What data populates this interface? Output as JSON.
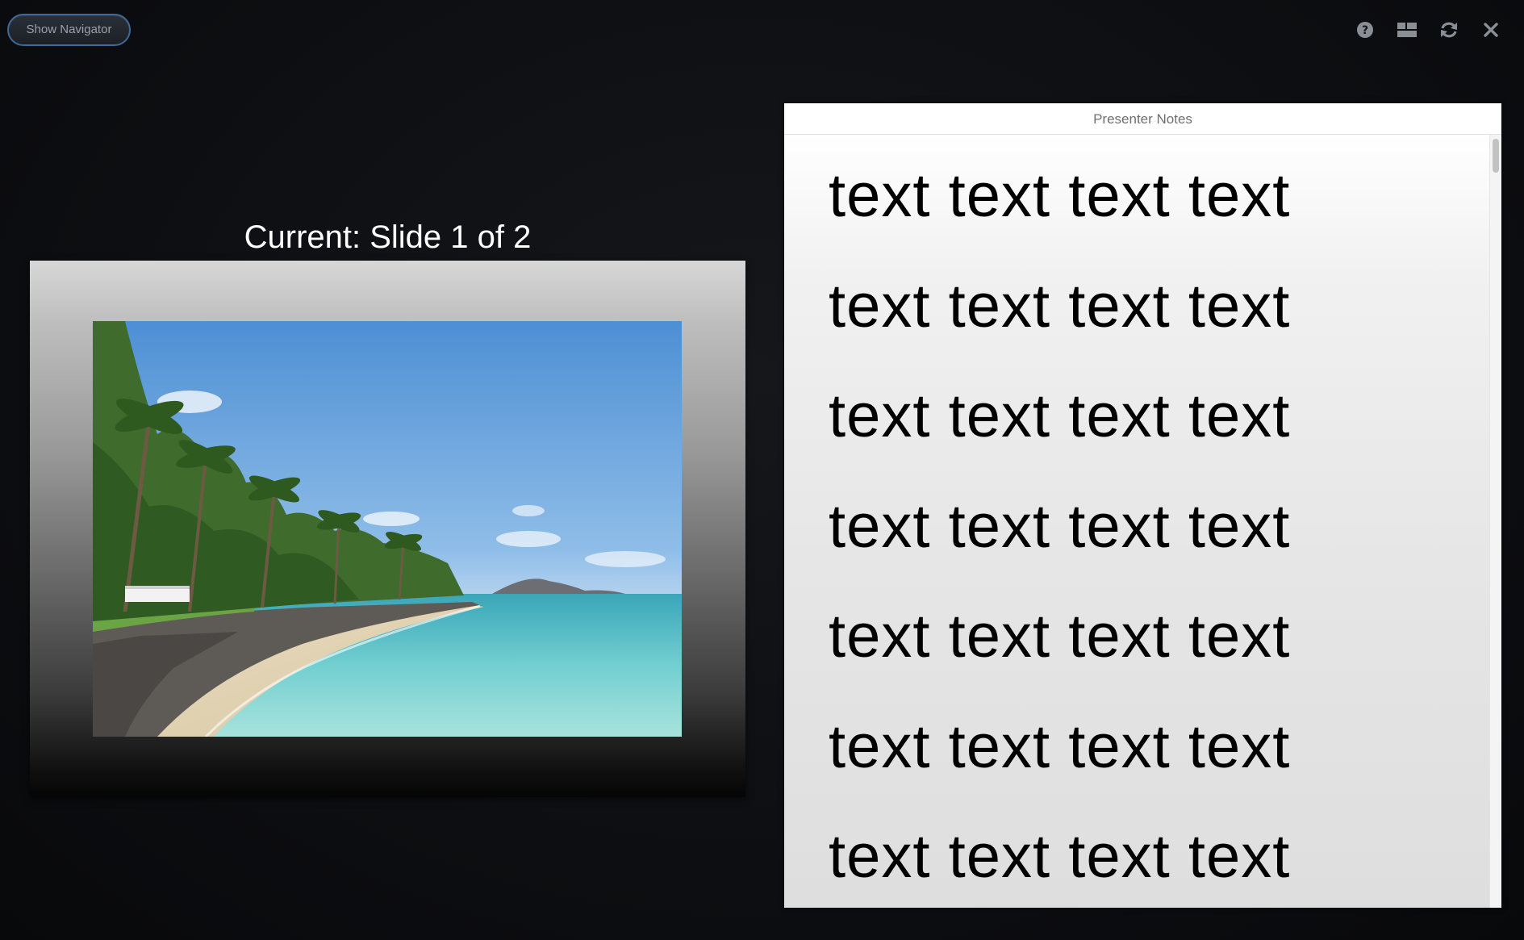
{
  "toolbar": {
    "show_navigator_label": "Show Navigator",
    "icons": [
      "help-icon",
      "layout-icon",
      "refresh-icon",
      "close-icon"
    ]
  },
  "slide": {
    "label": "Current: Slide 1 of 2",
    "image": "beach-photo"
  },
  "notes": {
    "title": "Presenter Notes",
    "lines": [
      "text text text text",
      "text text text text",
      "text text text text",
      "text text text text",
      "text text text text",
      "text text text text",
      "text text text text"
    ]
  },
  "colors": {
    "accent_border": "#3d6a98",
    "background": "#0f1013",
    "icon": "#8a8f96"
  }
}
